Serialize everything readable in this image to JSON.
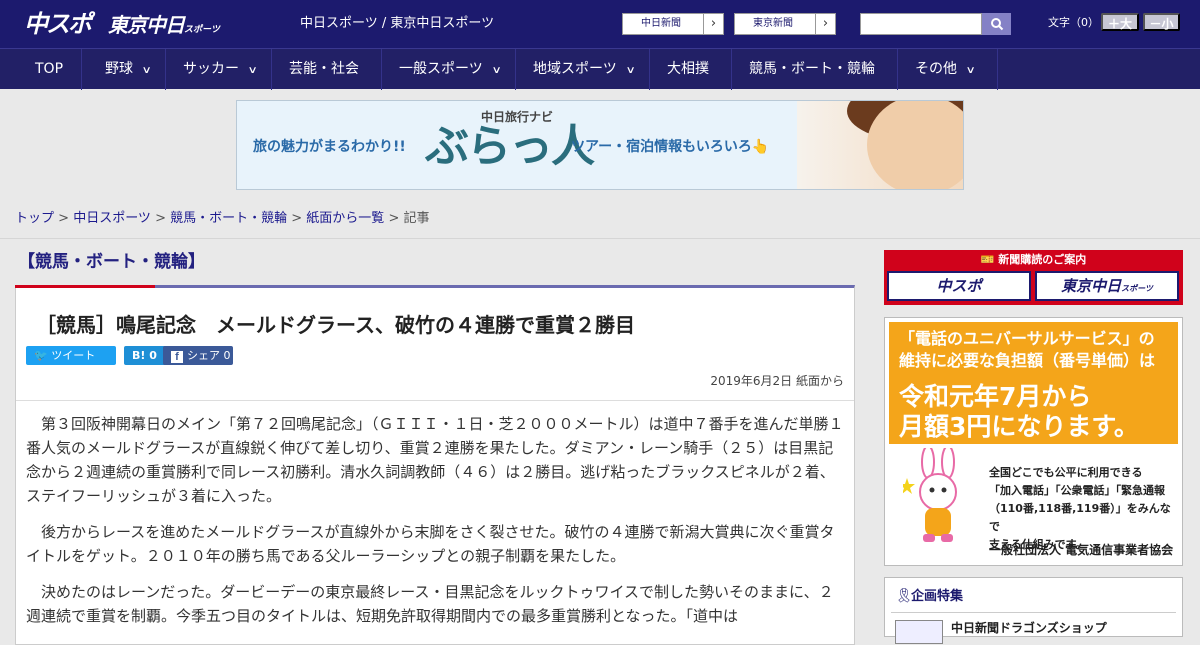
{
  "header": {
    "logo_chuspo": "中スポ",
    "logo_tokyo": "東京中日",
    "logo_tokyo_small": "スポーツ",
    "site_names": "中日スポーツ / 東京中日スポーツ",
    "site_buttons": [
      "中日新聞",
      "東京新聞"
    ],
    "search": {
      "placeholder": ""
    },
    "font_size_label": "文字（0）",
    "font_larger": "＋大",
    "font_smaller": "－小"
  },
  "nav": {
    "items": [
      {
        "label": "TOP"
      },
      {
        "label": "野球"
      },
      {
        "label": "サッカー"
      },
      {
        "label": "芸能・社会"
      },
      {
        "label": "一般スポーツ"
      },
      {
        "label": "地域スポーツ"
      },
      {
        "label": "大相撲"
      },
      {
        "label": "競馬・ボート・競輪"
      },
      {
        "label": "その他"
      }
    ]
  },
  "banner": {
    "sub": "中日旅行ナビ",
    "left": "旅の魅力がまるわかり!!",
    "brand": "ぶらっ人",
    "right": "ツアー・宿泊情報もいろいろ👆"
  },
  "breadcrumb": {
    "items": [
      "トップ",
      "中日スポーツ",
      "競馬・ボート・競輪",
      "紙面から一覧"
    ],
    "current": "記事",
    "sep": " > "
  },
  "category": "【競馬・ボート・競輪】",
  "article": {
    "headline": "［競馬］鳴尾記念　メールドグラース、破竹の４連勝で重賞２勝目",
    "tweet": "ツイート",
    "hatena": "B! 0",
    "share": "シェア 0",
    "date": "2019年6月2日 紙面から",
    "paragraphs": [
      "第３回阪神開幕日のメイン「第７２回鳴尾記念」（ＧＩＩＩ・１日・芝２０００メートル）は道中７番手を進んだ単勝１番人気のメールドグラースが直線鋭く伸びて差し切り、重賞２連勝を果たした。ダミアン・レーン騎手（２５）は目黒記念から２週連続の重賞勝利で同レース初勝利。清水久詞調教師（４６）は２勝目。逃げ粘ったブラックスピネルが２着、ステイフーリッシュが３着に入った。",
      "後方からレースを進めたメールドグラースが直線外から末脚をさく裂させた。破竹の４連勝で新潟大賞典に次ぐ重賞タイトルをゲット。２０１０年の勝ち馬である父ルーラーシップとの親子制覇を果たした。",
      "決めたのはレーンだった。ダービーデーの東京最終レース・目黒記念をルックトゥワイスで制した勢いそのままに、２週連続で重賞を制覇。今季五つ目のタイトルは、短期免許取得期間内での最多重賞勝利となった。「道中は"
    ]
  },
  "sidebar": {
    "subscribe_header": "新聞購読のご案内",
    "subscribe_chuspo": "中スポ",
    "subscribe_tokyo": "東京中日",
    "subscribe_tokyo_small": "スポーツ",
    "univ_line1": "「電話のユニバーサルサービス」の",
    "univ_line2": "維持に必要な負担額（番号単価）は",
    "univ_big1": "令和元年7月から",
    "univ_big2": "月額3円になります。",
    "univ_small": [
      "全国どこでも公平に利用できる",
      "「加入電話」「公衆電話」「緊急通報",
      "（110番,118番,119番）」をみんなで",
      "支える仕組みです。"
    ],
    "univ_org": "一般社団法人 電気通信事業者協会",
    "feature_title": "企画特集",
    "feature_item": "中日新聞ドラゴンズショップ"
  }
}
